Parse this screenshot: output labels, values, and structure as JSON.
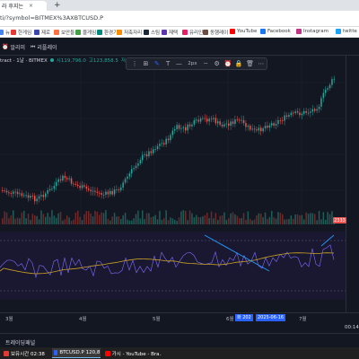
{
  "browser": {
    "tab_title": "라 후지는",
    "tab_close": "×",
    "new_tab": "+",
    "url": "ti/?symbol=BITMEX%3AXBTCUSD.P"
  },
  "bookmarks": [
    {
      "label": "뉴",
      "color": "#4285f4"
    },
    {
      "label": "한게임",
      "color": "#e53935"
    },
    {
      "label": "제로",
      "color": "#3949ab"
    },
    {
      "label": "보안들",
      "color": "#ff7043"
    },
    {
      "label": "블게임",
      "color": "#43a047"
    },
    {
      "label": "환경기",
      "color": "#00897b"
    },
    {
      "label": "저축자리",
      "color": "#fb8c00"
    },
    {
      "label": "스팀",
      "color": "#1b2838"
    },
    {
      "label": "재택",
      "color": "#5e35b1"
    },
    {
      "label": "유리인",
      "color": "#e91e63"
    },
    {
      "label": "동행레이",
      "color": "#6d4c41"
    },
    {
      "label": "YouTube",
      "color": "#ff0000"
    },
    {
      "label": "Facebook",
      "color": "#1877f2"
    },
    {
      "label": "Instagram",
      "color": "#c13584"
    },
    {
      "label": "twitte",
      "color": "#1da1f2"
    }
  ],
  "tv_toolbar": {
    "item1": "알리미",
    "item2": "리플레이"
  },
  "legend": {
    "symbol": "tract · 1날 · BITMEX",
    "o": "시119,796.0",
    "h": "고123,858.5",
    "l": "저119,0"
  },
  "drawbar": {
    "px_label": "2px"
  },
  "volume_badge": "2333",
  "time_axis": {
    "labels": [
      "3월",
      "4월",
      "5월",
      "6월",
      "7월"
    ],
    "marker_date": "화 202",
    "marker_range": "2025-06-16"
  },
  "bottom_time": "00:14",
  "panel_label": "트레이딩패널",
  "taskbar": [
    {
      "label": "보유시간  02:38",
      "color": "#e53935"
    },
    {
      "label": "BTCUSD.P 120,815.0...",
      "color": "#2962ff"
    },
    {
      "label": "가시 - YouTube - Bra...",
      "color": "#ff0000"
    }
  ],
  "colors": {
    "up": "#26a69a",
    "down": "#ef5350",
    "oscillator_fast": "#7e6fff",
    "oscillator_slow": "#c9a227",
    "trendline": "#2196f3"
  }
}
